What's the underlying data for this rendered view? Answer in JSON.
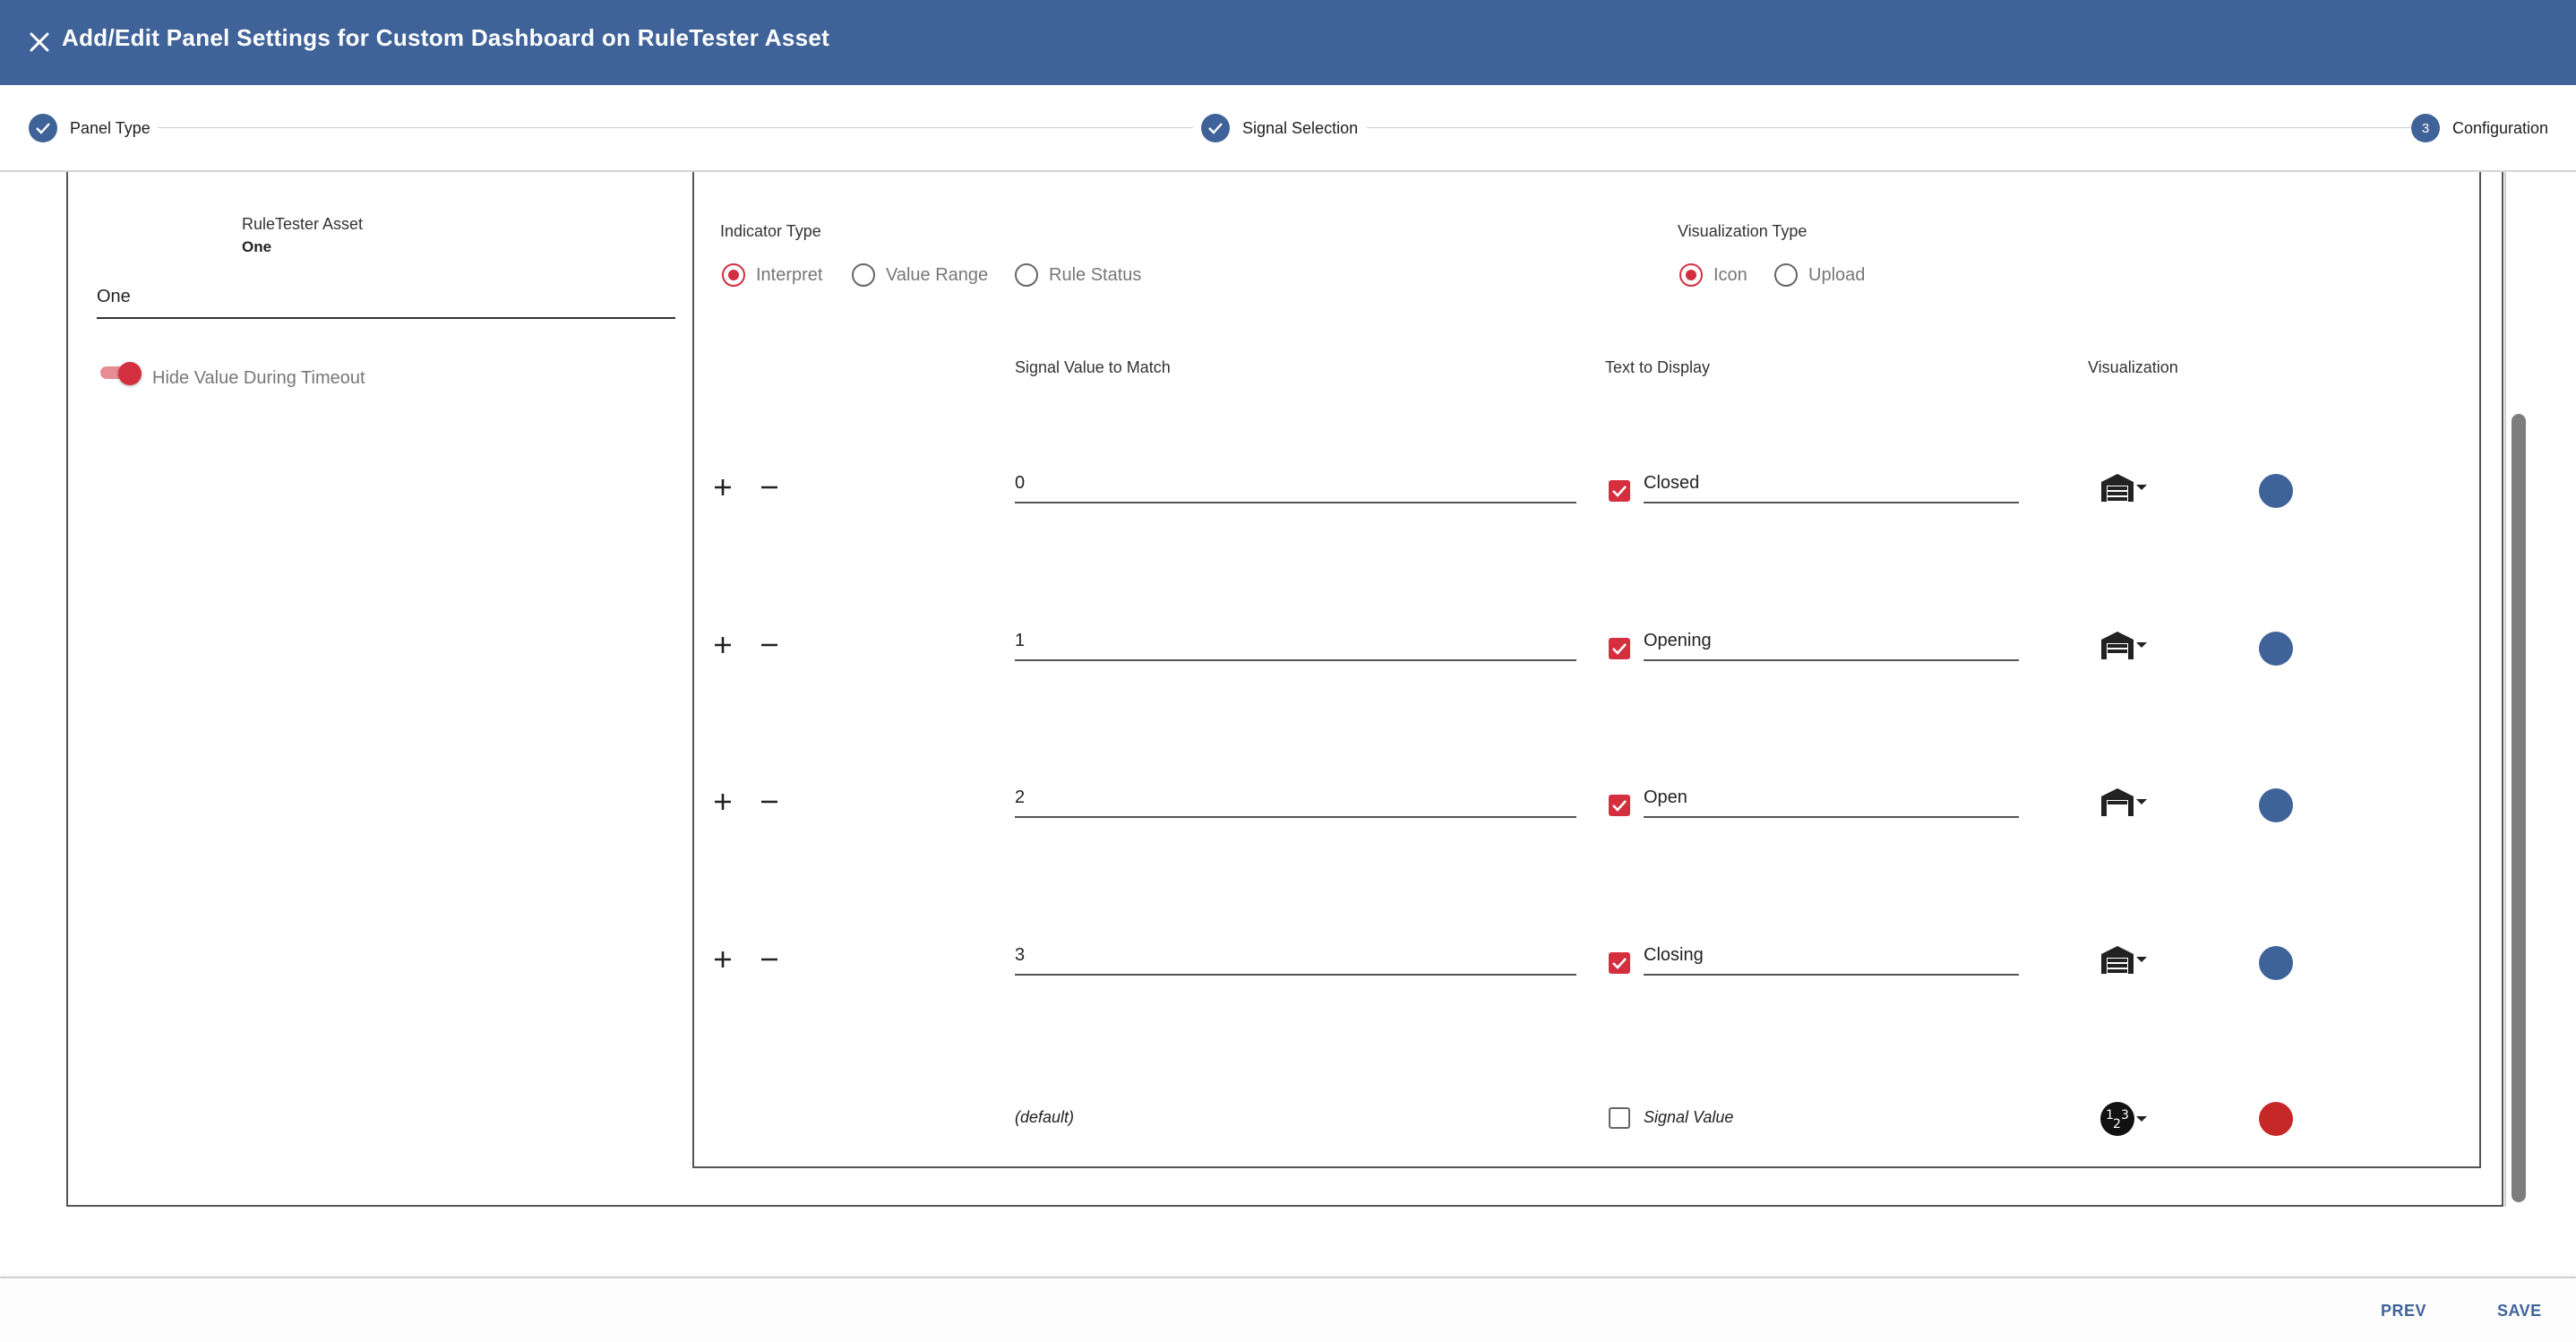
{
  "dialog": {
    "title": "Add/Edit Panel Settings for Custom Dashboard on RuleTester Asset"
  },
  "stepper": {
    "steps": [
      {
        "label": "Panel Type",
        "state": "done"
      },
      {
        "label": "Signal Selection",
        "state": "done"
      },
      {
        "label": "Configuration",
        "state": "active",
        "number": "3"
      }
    ]
  },
  "left": {
    "asset_label": "RuleTester Asset",
    "asset_value": "One",
    "name_value": "One",
    "toggle_label": "Hide Value During Timeout",
    "toggle_on": true
  },
  "indicator": {
    "label": "Indicator Type",
    "options": [
      "Interpret",
      "Value Range",
      "Rule Status"
    ],
    "selected": "Interpret"
  },
  "visualization_type": {
    "label": "Visualization Type",
    "options": [
      "Icon",
      "Upload"
    ],
    "selected": "Icon"
  },
  "columns": {
    "signal_value": "Signal Value to Match",
    "text_display": "Text to Display",
    "visualization": "Visualization"
  },
  "rows": [
    {
      "value": "0",
      "checked": true,
      "text": "Closed",
      "icon": "garage-closed-icon",
      "color": "#3f6399"
    },
    {
      "value": "1",
      "checked": true,
      "text": "Opening",
      "icon": "garage-opening-icon",
      "color": "#3f6399"
    },
    {
      "value": "2",
      "checked": true,
      "text": "Open",
      "icon": "garage-open-icon",
      "color": "#3f6399"
    },
    {
      "value": "3",
      "checked": true,
      "text": "Closing",
      "icon": "garage-closing-icon",
      "color": "#3f6399"
    }
  ],
  "default_row": {
    "value": "(default)",
    "checked": false,
    "text": "Signal Value",
    "icon": "numeric-123-icon",
    "color": "#c62828"
  },
  "footer": {
    "prev": "PREV",
    "save": "SAVE"
  },
  "colors": {
    "brand": "#3f6399",
    "accent": "#d32f3f"
  }
}
